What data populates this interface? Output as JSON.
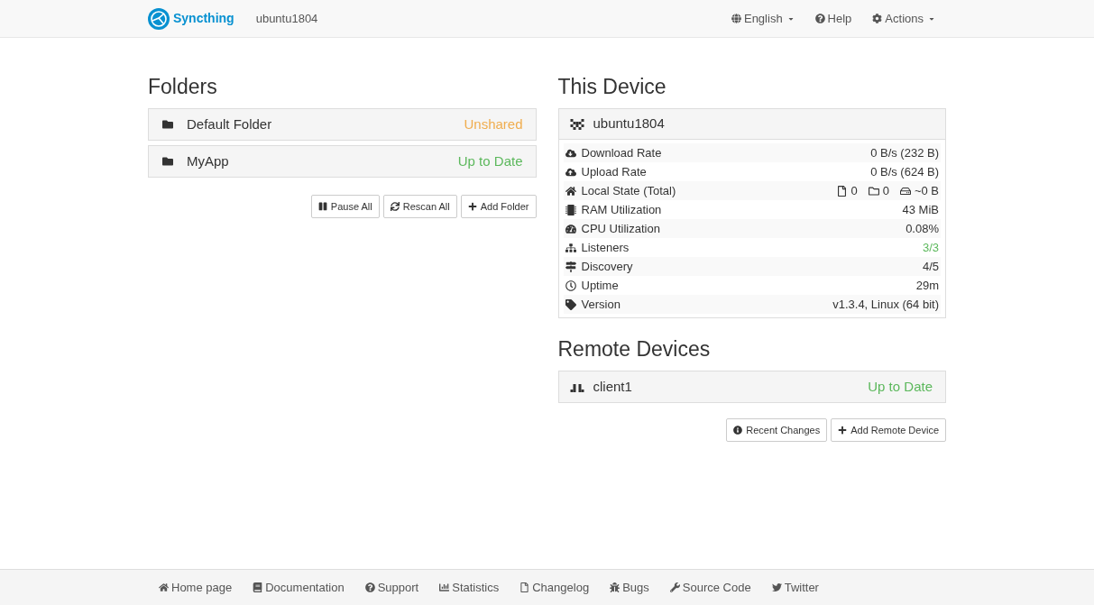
{
  "navbar": {
    "brand": "Syncthing",
    "device_name": "ubuntu1804",
    "menu": [
      {
        "label": "English",
        "dropdown": true
      },
      {
        "label": "Help",
        "dropdown": false
      },
      {
        "label": "Actions",
        "dropdown": true
      }
    ]
  },
  "folders": {
    "title": "Folders",
    "items": [
      {
        "name": "Default Folder",
        "status": "Unshared",
        "color": "#f0ad4e"
      },
      {
        "name": "MyApp",
        "status": "Up to Date",
        "color": "#5cb85c"
      }
    ],
    "buttons": [
      "Pause All",
      "Rescan All",
      "Add Folder"
    ]
  },
  "this_device": {
    "title": "This Device",
    "name": "ubuntu1804",
    "stats": [
      {
        "kind": "plain",
        "label": "Download Rate",
        "value": "0 B/s (232 B)",
        "color": "#333333"
      },
      {
        "kind": "plain",
        "label": "Upload Rate",
        "value": "0 B/s (624 B)",
        "color": "#333333"
      },
      {
        "kind": "local_state",
        "label": "Local State (Total)",
        "files": "0",
        "dirs": "0",
        "size": "~0 B",
        "color": "#333333"
      },
      {
        "kind": "plain",
        "label": "RAM Utilization",
        "value": "43 MiB",
        "color": "#333333"
      },
      {
        "kind": "plain",
        "label": "CPU Utilization",
        "value": "0.08%",
        "color": "#333333"
      },
      {
        "kind": "plain",
        "label": "Listeners",
        "value": "3/3",
        "color": "#5cb85c"
      },
      {
        "kind": "plain",
        "label": "Discovery",
        "value": "4/5",
        "color": "#333333"
      },
      {
        "kind": "plain",
        "label": "Uptime",
        "value": "29m",
        "color": "#333333"
      },
      {
        "kind": "plain",
        "label": "Version",
        "value": "v1.3.4, Linux (64 bit)",
        "color": "#333333"
      }
    ]
  },
  "remote_devices": {
    "title": "Remote Devices",
    "items": [
      {
        "name": "client1",
        "status": "Up to Date",
        "color": "#5cb85c"
      }
    ],
    "buttons": [
      "Recent Changes",
      "Add Remote Device"
    ]
  },
  "footer": [
    "Home page",
    "Documentation",
    "Support",
    "Statistics",
    "Changelog",
    "Bugs",
    "Source Code",
    "Twitter"
  ]
}
